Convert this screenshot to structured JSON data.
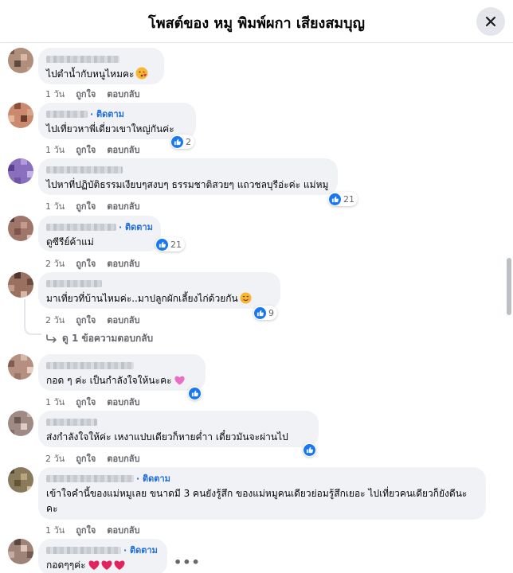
{
  "header": {
    "title": "โพสต์ของ หมู พิมพ์ผกา เสียงสมบุญ"
  },
  "labels": {
    "like": "ถูกใจ",
    "reply": "ตอบกลับ",
    "follow": "ติดตาม"
  },
  "comments": [
    {
      "text": "ไปตำน้ำกับหนูไหมคะ",
      "time": "1 วัน",
      "follow": false
    },
    {
      "text": "ไปเที่ยวหาพี่เดี่ยวเขาใหญ่กันค่ะ",
      "time": "1 วัน",
      "follow": true,
      "reactions": "2"
    },
    {
      "text": "ไปหาที่ปฏิบัติธรรมเงียบๆสงบๆ ธรรมชาติสวยๆ แถวชลบุรีอ่ะค่ะ แม่หมู",
      "time": "1 วัน",
      "follow": false,
      "reactions": "21"
    },
    {
      "text": "ดูซีรีย์ค้าแม่",
      "time": "2 วัน",
      "follow": true,
      "reactions": "21"
    },
    {
      "text": "มาเที่ยวที่บ้านไหมค่ะ..มาปลูกผักเลี้ยงไก่ด้วยกัน",
      "time": "2 วัน",
      "follow": false,
      "reactions": "9"
    },
    {
      "text": "กอด ๆ ค่ะ เป็นกำลังใจให้นะคะ",
      "time": "1 วัน",
      "follow": false
    },
    {
      "text": "ส่งกำลังใจให้ค่ะ เหงาแปบเดียวก็หายค่ำา เดี๋ยวมันจะผ่านไป",
      "time": "2 วัน",
      "follow": false
    },
    {
      "text": "เข้าใจคำนี้ของแม่หมูเลย ขนาดมี 3 คนยังรู้สึก ของแม่หมูคนเดียวย่อมรู้สึกเยอะ ไปเที่ยวคนเดียวก็ยังดีนะคะ",
      "time": "1 วัน",
      "follow": true
    },
    {
      "text": "กอดๆๆค่ะ",
      "time": "",
      "follow": true
    }
  ],
  "view_replies": "ดู 1 ข้อความตอบกลับ",
  "more": "•••",
  "colors": {
    "accent": "#1877f2",
    "bubble": "#f0f2f5",
    "muted": "#65676b"
  },
  "icons": [
    "close-icon",
    "like-reaction-icon",
    "reply-arrow-icon",
    "heart-icon",
    "smiley-icon",
    "face-blowing-kiss-icon"
  ]
}
